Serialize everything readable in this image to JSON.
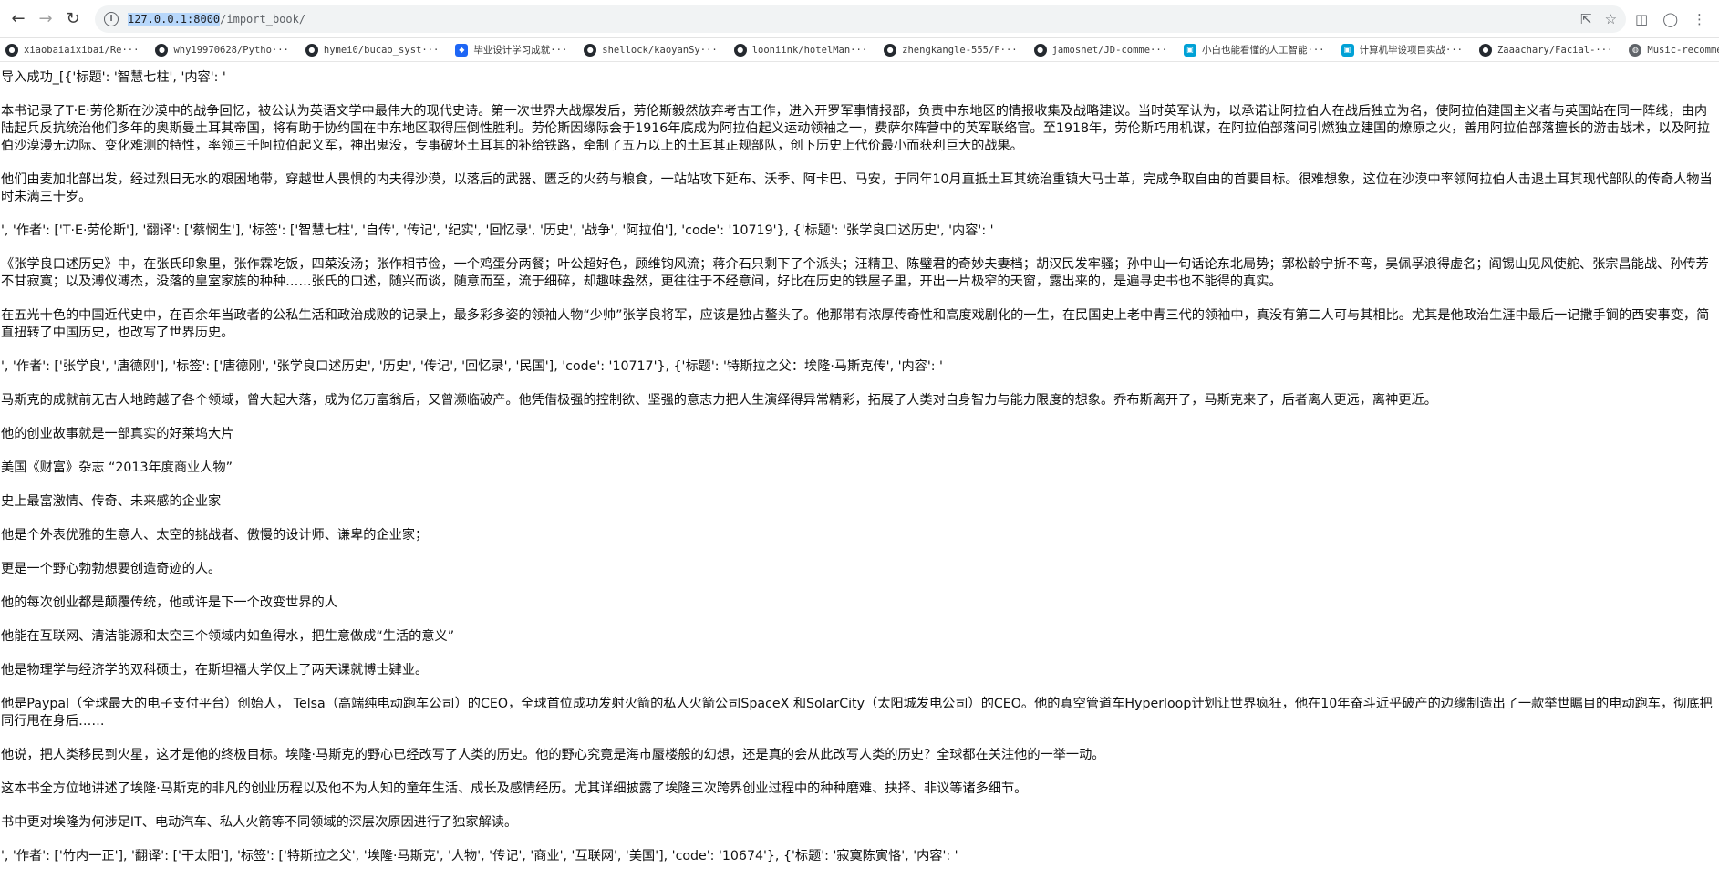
{
  "browser": {
    "url_host": "127.0.0.1:8000",
    "url_path": "/import_book/",
    "bookmarks": [
      {
        "icon": "github-icon",
        "label": "xiaobaiaixibai/Re···"
      },
      {
        "icon": "github-icon",
        "label": "why19970628/Pytho···"
      },
      {
        "icon": "github-icon",
        "label": "hymei0/bucao_syst···"
      },
      {
        "icon": "blue-square-icon",
        "label": "毕业设计学习成就···"
      },
      {
        "icon": "github-icon",
        "label": "shellock/kaoyanSy···"
      },
      {
        "icon": "github-icon",
        "label": "looniink/hotelMan···"
      },
      {
        "icon": "github-icon",
        "label": "zhengkangle-555/F···"
      },
      {
        "icon": "github-icon",
        "label": "jamosnet/JD-comme···"
      },
      {
        "icon": "bilibili-icon",
        "label": "小白也能看懂的人工智能···"
      },
      {
        "icon": "bilibili-icon",
        "label": "计算机毕设项目实战···"
      },
      {
        "icon": "github-icon",
        "label": "Zaaachary/Facial-···"
      },
      {
        "icon": "globe-icon",
        "label": "Music-recommendat···"
      }
    ]
  },
  "page": {
    "paragraphs": [
      "导入成功_[{'标题': '智慧七柱', '内容': '",
      "本书记录了T·E·劳伦斯在沙漠中的战争回忆，被公认为英语文学中最伟大的现代史诗。第一次世界大战爆发后，劳伦斯毅然放弃考古工作，进入开罗军事情报部，负责中东地区的情报收集及战略建议。当时英军认为，以承诺让阿拉伯人在战后独立为名，使阿拉伯建国主义者与英国站在同一阵线，由内陆起兵反抗统治他们多年的奥斯曼土耳其帝国，将有助于协约国在中东地区取得压倒性胜利。劳伦斯因缘际会于1916年底成为阿拉伯起义运动领袖之一，费萨尔阵营中的英军联络官。至1918年，劳伦斯巧用机谋，在阿拉伯部落间引燃独立建国的燎原之火，善用阿拉伯部落擅长的游击战术，以及阿拉伯沙漠漫无边际、变化难测的特性，率领三千阿拉伯起义军，神出鬼没，专事破坏土耳其的补给铁路，牵制了五万以上的土耳其正规部队，创下历史上代价最小而获利巨大的战果。",
      "他们由麦加北部出发，经过烈日无水的艰困地带，穿越世人畏惧的内夫得沙漠，以落后的武器、匮乏的火药与粮食，一站站攻下延布、沃季、阿卡巴、马安，于同年10月直抵土耳其统治重镇大马士革，完成争取自由的首要目标。很难想象，这位在沙漠中率领阿拉伯人击退土耳其现代部队的传奇人物当时未满三十岁。",
      "', '作者': ['T·E·劳伦斯'], '翻译': ['蔡悯生'], '标签': ['智慧七柱', '自传', '传记', '纪实', '回忆录', '历史', '战争', '阿拉伯'], 'code': '10719'}, {'标题': '张学良口述历史', '内容': '",
      "《张学良口述历史》中，在张氏印象里，张作霖吃饭，四菜没汤；张作相节俭，一个鸡蛋分两餐；叶公超好色，顾维钧风流；蒋介石只剩下了个派头；汪精卫、陈璧君的奇妙夫妻档；胡汉民发牢骚；孙中山一句话论东北局势；郭松龄宁折不弯，吴佩孚浪得虚名；阎锡山见风使舵、张宗昌能战、孙传芳不甘寂寞；以及溥仪溥杰，没落的皇室家族的种种……张氏的口述，随兴而谈，随意而至，流于细碎，却趣味盎然，更往往于不经意间，好比在历史的铁屋子里，开出一片极窄的天窗，露出来的，是遍寻史书也不能得的真实。",
      "在五光十色的中国近代史中，在百余年当政者的公私生活和政治成败的记录上，最多彩多姿的领袖人物“少帅”张学良将军，应该是独占鳌头了。他那带有浓厚传奇性和高度戏剧化的一生，在民国史上老中青三代的领袖中，真没有第二人可与其相比。尤其是他政治生涯中最后一记撒手锏的西安事变，简直扭转了中国历史，也改写了世界历史。",
      "', '作者': ['张学良', '唐德刚'], '标签': ['唐德刚', '张学良口述历史', '历史', '传记', '回忆录', '民国'], 'code': '10717'}, {'标题': '特斯拉之父：埃隆·马斯克传', '内容': '",
      "马斯克的成就前无古人地跨越了各个领域，曾大起大落，成为亿万富翁后，又曾濒临破产。他凭借极强的控制欲、坚强的意志力把人生演绎得异常精彩，拓展了人类对自身智力与能力限度的想象。乔布斯离开了，马斯克来了，后者离人更远，离神更近。",
      "他的创业故事就是一部真实的好莱坞大片",
      "美国《财富》杂志 “2013年度商业人物”",
      "史上最富激情、传奇、未来感的企业家",
      "他是个外表优雅的生意人、太空的挑战者、傲慢的设计师、谦卑的企业家；",
      "更是一个野心勃勃想要创造奇迹的人。",
      "他的每次创业都是颠覆传统，他或许是下一个改变世界的人",
      "他能在互联网、清洁能源和太空三个领域内如鱼得水，把生意做成“生活的意义”",
      "他是物理学与经济学的双科硕士，在斯坦福大学仅上了两天课就博士肄业。",
      "他是Paypal（全球最大的电子支付平台）创始人，  Telsa（高端纯电动跑车公司）的CEO，全球首位成功发射火箭的私人火箭公司SpaceX 和SolarCity（太阳城发电公司）的CEO。他的真空管道车Hyperloop计划让世界疯狂，他在10年奋斗近乎破产的边缘制造出了一款举世瞩目的电动跑车，彻底把同行甩在身后……",
      "他说，把人类移民到火星，这才是他的终极目标。埃隆·马斯克的野心已经改写了人类的历史。他的野心究竟是海市蜃楼般的幻想，还是真的会从此改写人类的历史？全球都在关注他的一举一动。",
      "这本书全方位地讲述了埃隆·马斯克的非凡的创业历程以及他不为人知的童年生活、成长及感情经历。尤其详细披露了埃隆三次跨界创业过程中的种种磨难、抉择、非议等诸多细节。",
      "书中更对埃隆为何涉足IT、电动汽车、私人火箭等不同领域的深层次原因进行了独家解读。",
      "', '作者': ['竹内一正'], '翻译': ['干太阳'], '标签': ['特斯拉之父', '埃隆·马斯克', '人物', '传记', '商业', '互联网', '美国'], 'code': '10674'}, {'标题': '寂寞陈寅恪', '内容': '"
    ]
  }
}
